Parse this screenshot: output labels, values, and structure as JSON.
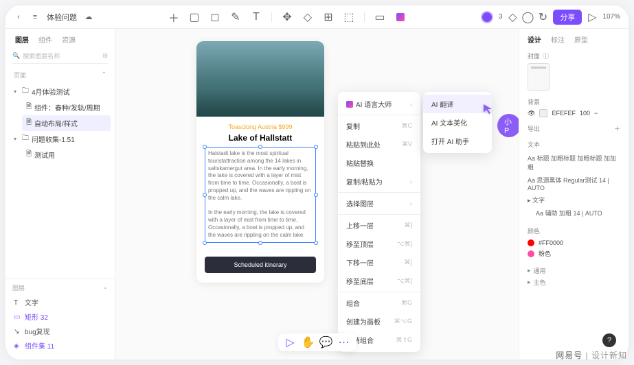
{
  "topbar": {
    "doc_title": "体验问题",
    "collab_count": "3",
    "share_label": "分享",
    "zoom": "107%"
  },
  "left": {
    "tabs": [
      "图层",
      "组件",
      "资源"
    ],
    "search_placeholder": "搜索图层名称",
    "pages_label": "页面",
    "tree": [
      {
        "label": "4月体验测试",
        "expanded": true,
        "children": [
          {
            "label": "组件：春种/发轨/周期"
          },
          {
            "label": "自动布局/样式",
            "selected": true
          }
        ]
      },
      {
        "label": "问题收集-1.51",
        "expanded": true,
        "children": [
          {
            "label": "测试用"
          }
        ]
      }
    ],
    "bottom_label": "图层",
    "bottom_items": [
      {
        "label": "文字",
        "color": "#555",
        "icon": "text"
      },
      {
        "label": "矩形 32",
        "color": "#7c4dff",
        "icon": "rect"
      },
      {
        "label": "bug复现",
        "color": "#555",
        "icon": "link"
      },
      {
        "label": "组件集 11",
        "color": "#7c4dff",
        "icon": "comp"
      }
    ]
  },
  "artboard": {
    "tag": "Toasciong Austria $999",
    "title": "Lake of Hallstatt",
    "para1": "Halstadt lake is the most spiritual touristattraction among the 14 lakes in saltskamergut area. In the early morning, the lake is covered with a layer of mist from time to time. Occasionally, a boat is propped up, and the waves are rippling on the calm lake.",
    "para2": "In the early morning, the lake is covered with a layer of mist from time to time. Occasionally, a boat is propped up, and the waves are rippling on the calm lake.",
    "button": "Scheduled itinerary"
  },
  "contextmenu": {
    "ai_label": "AI 语言大师",
    "items": [
      {
        "label": "复制",
        "shortcut": "⌘C"
      },
      {
        "label": "粘贴到此处",
        "shortcut": "⌘V"
      },
      {
        "label": "粘贴替换"
      },
      {
        "label": "复制/粘贴为",
        "arrow": true
      },
      {
        "label": "选择图层",
        "arrow": true
      },
      {
        "label": "上移一层",
        "shortcut": "⌘]"
      },
      {
        "label": "移至顶层",
        "shortcut": "⌥⌘]"
      },
      {
        "label": "下移一层",
        "shortcut": "⌘["
      },
      {
        "label": "移至底层",
        "shortcut": "⌥⌘["
      },
      {
        "label": "组合",
        "shortcut": "⌘G"
      },
      {
        "label": "创建为画板",
        "shortcut": "⌘⌥G"
      },
      {
        "label": "取消组合",
        "shortcut": "⌘⇧G"
      }
    ]
  },
  "submenu": {
    "items": [
      "AI 翻译",
      "AI 文本美化",
      "打开 AI 助手"
    ]
  },
  "cursor_label": "小P",
  "right": {
    "tabs": [
      "设计",
      "标注",
      "原型"
    ],
    "cover_label": "封面",
    "bg_label": "背景",
    "bg_value": "EFEFEF",
    "bg_opacity": "100",
    "export_label": "导出",
    "text_label": "文本",
    "font1": "Aa 标题 加粗标题 加粗标题 加加粗",
    "font2": "Aa 思源黑体 Regular测试 14 | AUTO",
    "font3_label": "文字",
    "font3": "Aa 辅助 加粗 14 | AUTO",
    "color_label": "颜色",
    "colors": [
      {
        "hex": "#FF0000",
        "label": "#FF0000"
      },
      {
        "hex": "#ff4da6",
        "label": "粉色"
      }
    ],
    "general_label": "通用",
    "main_color_label": "主色"
  },
  "watermark": {
    "brand": "网易号",
    "suffix": "| 设计新知"
  }
}
